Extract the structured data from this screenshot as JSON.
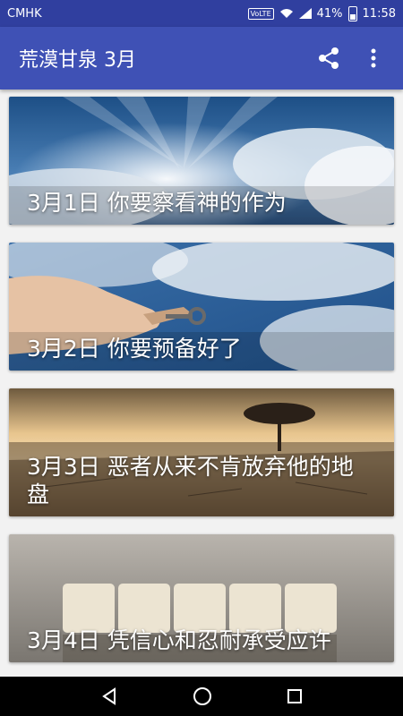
{
  "status": {
    "carrier": "CMHK",
    "volte": "VoLTE",
    "battery_percent": "41%",
    "time": "11:58"
  },
  "app_bar": {
    "title": "荒漠甘泉 3月",
    "actions": [
      "share-icon",
      "more-vert-icon"
    ]
  },
  "entries": [
    {
      "title": "3月1日 你要察看神的作为",
      "image": "sky-rays"
    },
    {
      "title": "3月2日 你要预备好了",
      "image": "hand-key"
    },
    {
      "title": "3月3日 恶者从来不肯放弃他的地盘",
      "image": "desert-tree"
    },
    {
      "title": "3月4日 凭信心和忍耐承受应许",
      "image": "faith-tiles"
    }
  ],
  "nav": [
    "back-icon",
    "home-icon",
    "recents-icon"
  ],
  "colors": {
    "status_bar": "#303f9f",
    "app_bar": "#3f51b5",
    "background": "#f2f2f2"
  }
}
